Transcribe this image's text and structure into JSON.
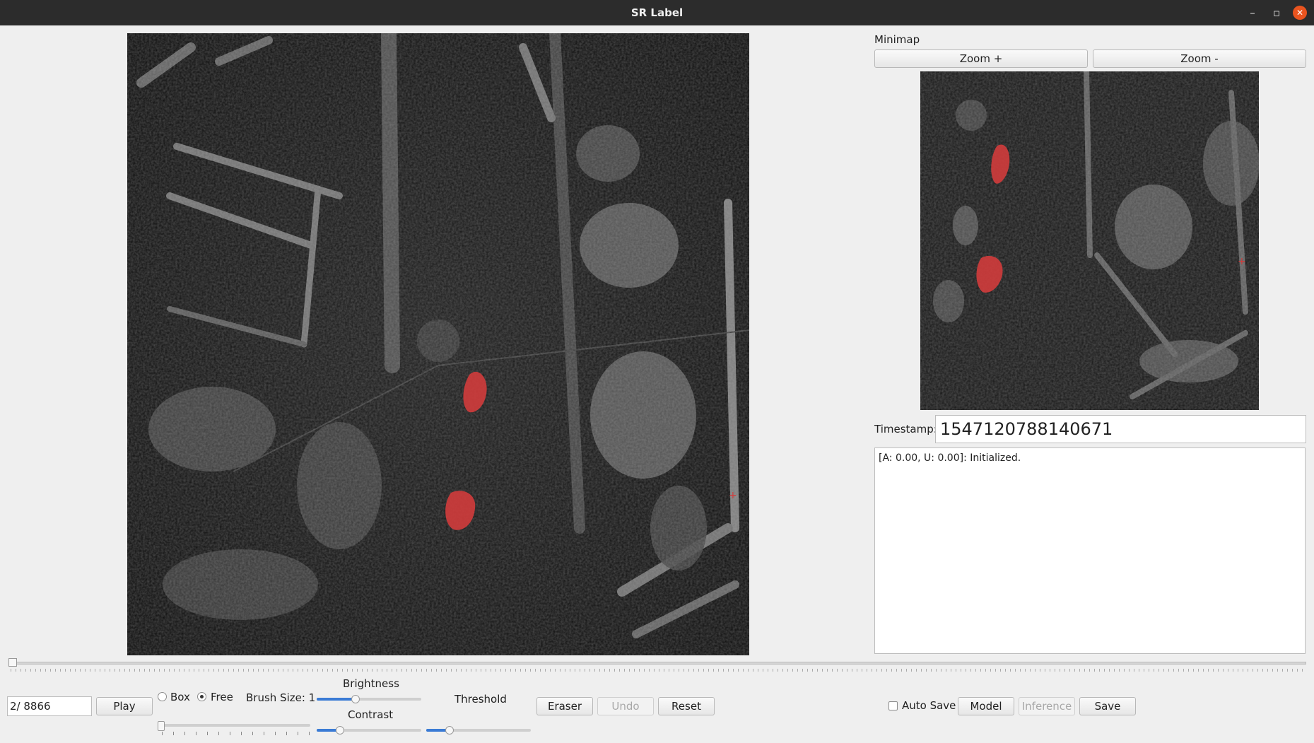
{
  "window": {
    "title": "SR Label"
  },
  "minimap": {
    "label": "Minimap",
    "zoom_in": "Zoom +",
    "zoom_out": "Zoom -"
  },
  "timestamp": {
    "label": "Timestamp:",
    "value": "1547120788140671"
  },
  "log": {
    "text": "[A: 0.00, U: 0.00]: Initialized."
  },
  "playback": {
    "frame": "2/ 8866",
    "play_label": "Play",
    "position": 0.0
  },
  "mode": {
    "box_label": "Box",
    "free_label": "Free",
    "selected": "Free"
  },
  "brush": {
    "label": "Brush Size: 1",
    "value": 1
  },
  "brightness": {
    "label": "Brightness",
    "level": 0.37
  },
  "contrast": {
    "label": "Contrast",
    "level": 0.22
  },
  "threshold": {
    "label": "Threshold",
    "level": 0.22
  },
  "tools": {
    "eraser": "Eraser",
    "undo": "Undo",
    "reset": "Reset"
  },
  "actions": {
    "auto_save_label": "Auto Save",
    "auto_save_checked": false,
    "model": "Model",
    "inference": "Inference",
    "save": "Save"
  },
  "colors": {
    "titlebar": "#2c2c2c",
    "close": "#e9541f",
    "label_overlay": "#d23c3c",
    "slider_accent": "#3a7bd5"
  }
}
